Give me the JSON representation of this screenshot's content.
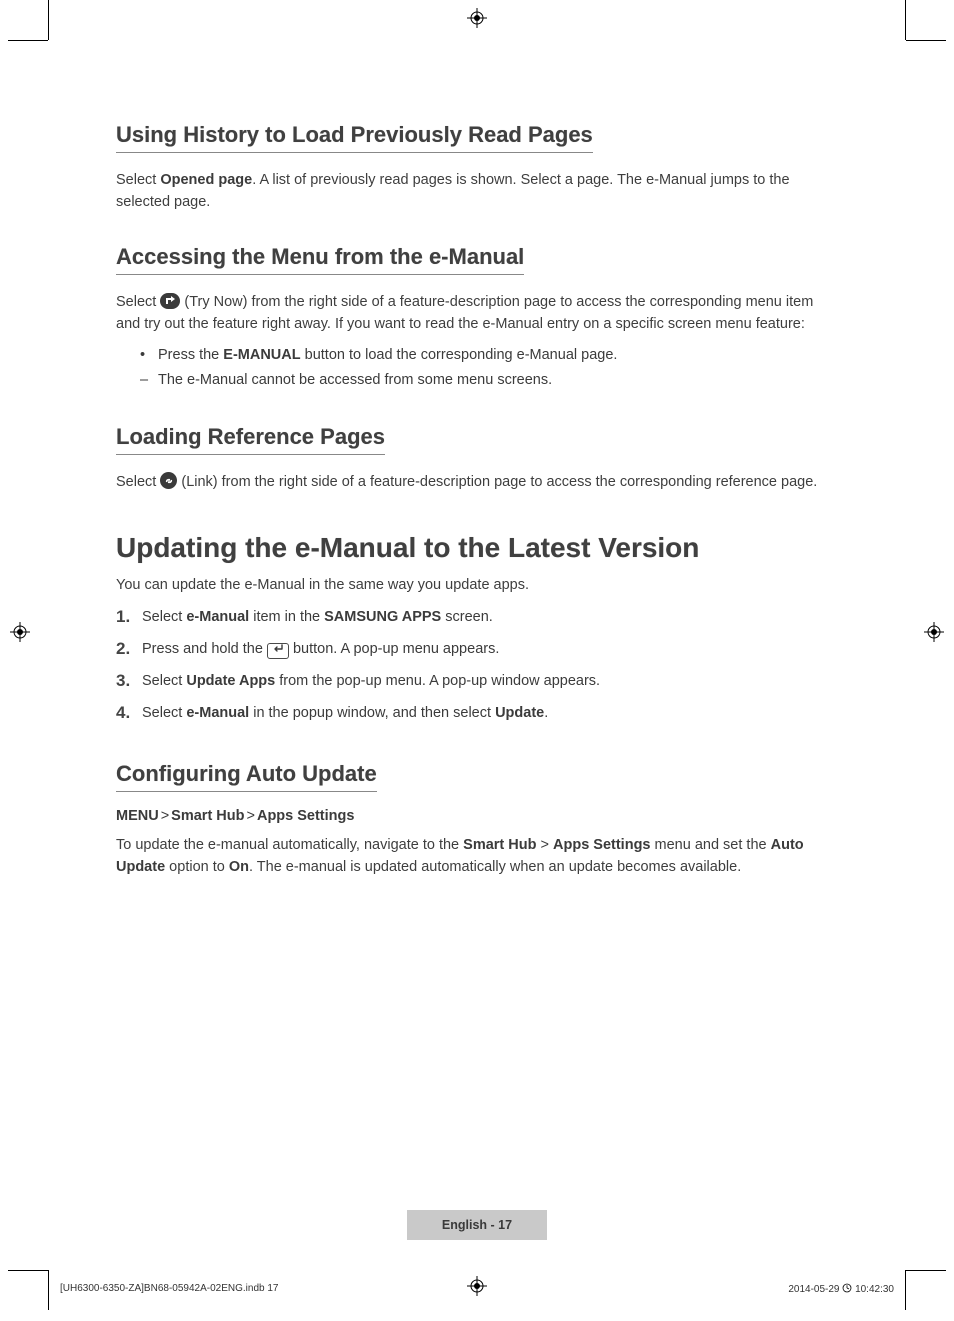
{
  "sections": {
    "s1": {
      "heading": "Using History to Load Previously Read Pages",
      "p_pre": "Select ",
      "p_bold": "Opened page",
      "p_post": ". A list of previously read pages is shown. Select a page. The e-Manual jumps to the selected page."
    },
    "s2": {
      "heading": "Accessing the Menu from the e-Manual",
      "p_pre": "Select ",
      "p_mid": " (Try Now) from the right side of a feature-description page to access the corresponding menu item and try out the feature right away. If you want to read the e-Manual entry on a specific screen menu feature:",
      "b1_pre": "Press the ",
      "b1_bold": "E-MANUAL",
      "b1_post": " button to load the corresponding e-Manual page.",
      "b2": "The e-Manual cannot be accessed from some menu screens."
    },
    "s3": {
      "heading": "Loading Reference Pages",
      "p_pre": "Select ",
      "p_post": " (Link) from the right side of a feature-description page to access the corresponding reference page."
    },
    "h1": "Updating the e-Manual to the Latest Version",
    "intro": "You can update the e-Manual in the same way you update apps.",
    "steps": {
      "st1_pre": "Select ",
      "st1_b1": "e-Manual",
      "st1_mid": " item in the ",
      "st1_b2": "SAMSUNG APPS",
      "st1_post": " screen.",
      "st2_pre": "Press and hold the ",
      "st2_post": " button. A pop-up menu appears.",
      "st3_pre": "Select ",
      "st3_b": "Update Apps",
      "st3_post": " from the pop-up menu. A pop-up window appears.",
      "st4_pre": "Select ",
      "st4_b1": "e-Manual",
      "st4_mid": " in the popup window, and then select ",
      "st4_b2": "Update",
      "st4_post": "."
    },
    "s4": {
      "heading": "Configuring Auto Update",
      "menu1": "MENU",
      "menu2": "Smart Hub",
      "menu3": "Apps Settings",
      "p_pre": "To update the e-manual automatically, navigate to the ",
      "p_b1": "Smart Hub",
      "p_chev": " > ",
      "p_b2": "Apps Settings",
      "p_mid": " menu and set the ",
      "p_b3": "Auto Update",
      "p_mid2": " option to ",
      "p_b4": "On",
      "p_post": ". The e-manual is updated automatically when an update becomes available."
    }
  },
  "footer": {
    "lang_label": "English - 17",
    "meta_left": "[UH6300-6350-ZA]BN68-05942A-02ENG.indb   17",
    "meta_date": "2014-05-29   ",
    "meta_time": "10:42:30"
  },
  "chevron": ">"
}
